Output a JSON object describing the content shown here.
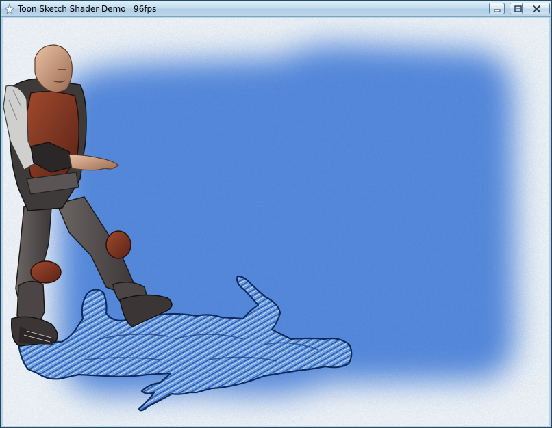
{
  "window": {
    "title": "Toon Sketch Shader Demo   96fps",
    "app_icon": "app-icon",
    "controls": [
      {
        "name": "minimize-button",
        "icon": "minimize-icon"
      },
      {
        "name": "maximize-button",
        "icon": "maximize-icon"
      },
      {
        "name": "close-button",
        "icon": "close-icon"
      }
    ]
  },
  "scene": {
    "background_color": "#ffffff",
    "sketch_fill_color": "#5b8ee2",
    "shadow_color": "#5d94e0",
    "shadow_outline_color": "#0e2a5c",
    "figure": "armored-soldier-character",
    "shadow": "sketched-character-shadow"
  }
}
